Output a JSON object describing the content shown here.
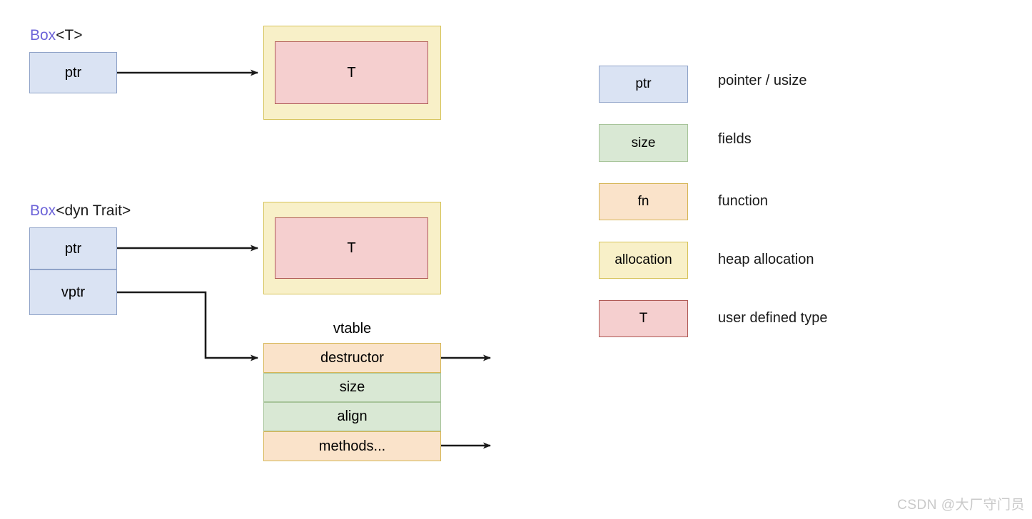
{
  "diagram": {
    "title_hidden": "",
    "colors": {
      "pointer_fill": "#dae3f3",
      "pointer_stroke": "#8fa3c8",
      "field_fill": "#d9e8d4",
      "field_stroke": "#a7c49a",
      "function_fill": "#fae3ca",
      "function_stroke": "#d6b656",
      "allocation_fill": "#f8f0c8",
      "allocation_stroke": "#d6c35a",
      "udt_fill": "#f5cfcf",
      "udt_stroke": "#b05a56",
      "keyword_text": "#6c63d8",
      "wire": "#1a1a1a",
      "watermark": "#c9c9c9"
    },
    "sections": [
      {
        "id": "box-t",
        "label_keyword": "Box",
        "label_generic": "<T>",
        "struct_fields": [
          {
            "name": "ptr",
            "label": "ptr",
            "role": "pointer"
          }
        ],
        "allocation": {
          "label": "allocation",
          "inner": {
            "label": "T",
            "role": "udt"
          }
        }
      },
      {
        "id": "box-dyn-trait",
        "label_keyword": "Box",
        "label_generic": "<dyn Trait>",
        "struct_fields": [
          {
            "name": "ptr",
            "label": "ptr",
            "role": "pointer"
          },
          {
            "name": "vptr",
            "label": "vptr",
            "role": "pointer"
          }
        ],
        "allocation": {
          "label": "allocation",
          "inner": {
            "label": "T",
            "role": "udt"
          }
        }
      }
    ],
    "vtable": {
      "caption": "vtable",
      "rows": [
        {
          "label": "destructor",
          "role": "function",
          "has_out_pointer": true
        },
        {
          "label": "size",
          "role": "field",
          "has_out_pointer": false
        },
        {
          "label": "align",
          "role": "field",
          "has_out_pointer": false
        },
        {
          "label": "methods...",
          "role": "function",
          "has_out_pointer": true
        }
      ]
    }
  },
  "legend": {
    "items": [
      {
        "swatch_label": "ptr",
        "role": "pointer",
        "description": "pointer / usize"
      },
      {
        "swatch_label": "size",
        "role": "field",
        "description": "fields"
      },
      {
        "swatch_label": "fn",
        "role": "function",
        "description": "function"
      },
      {
        "swatch_label": "allocation",
        "role": "allocation",
        "description": "heap allocation"
      },
      {
        "swatch_label": "T",
        "role": "udt",
        "description": "user defined type"
      }
    ]
  },
  "watermark": {
    "text": "CSDN @大厂守门员"
  }
}
